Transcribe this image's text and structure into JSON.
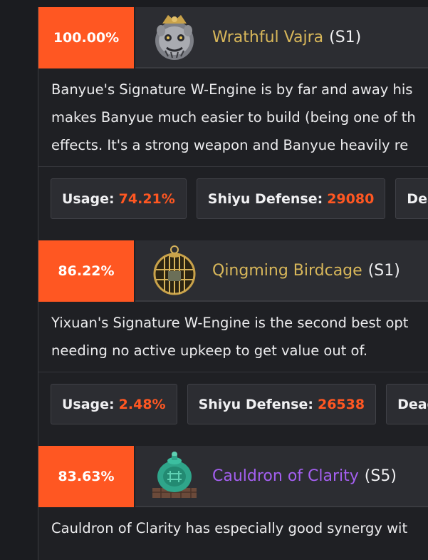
{
  "entries": [
    {
      "percent": "100.00%",
      "name": "Wrathful Vajra",
      "rank": "(S1)",
      "description": [
        "Banyue's Signature W-Engine is by far and away his",
        "makes Banyue much easier to build (being one of th",
        "effects. It's a strong weapon and Banyue heavily re"
      ],
      "stats": [
        {
          "label": "Usage:",
          "value": "74.21%"
        },
        {
          "label": "Shiyu Defense:",
          "value": "29080"
        },
        {
          "label": "Dead",
          "value": ""
        }
      ]
    },
    {
      "percent": "86.22%",
      "name": "Qingming Birdcage",
      "rank": "(S1)",
      "description": [
        "Yixuan's Signature W-Engine is the second best opt",
        "needing no active upkeep to get value out of."
      ],
      "stats": [
        {
          "label": "Usage:",
          "value": "2.48%"
        },
        {
          "label": "Shiyu Defense:",
          "value": "26538"
        },
        {
          "label": "Deadly",
          "value": ""
        }
      ]
    },
    {
      "percent": "83.63%",
      "name": "Cauldron of Clarity",
      "rank": "(S5)",
      "description": [
        "Cauldron of Clarity has especially good synergy wit"
      ],
      "stats": []
    }
  ]
}
